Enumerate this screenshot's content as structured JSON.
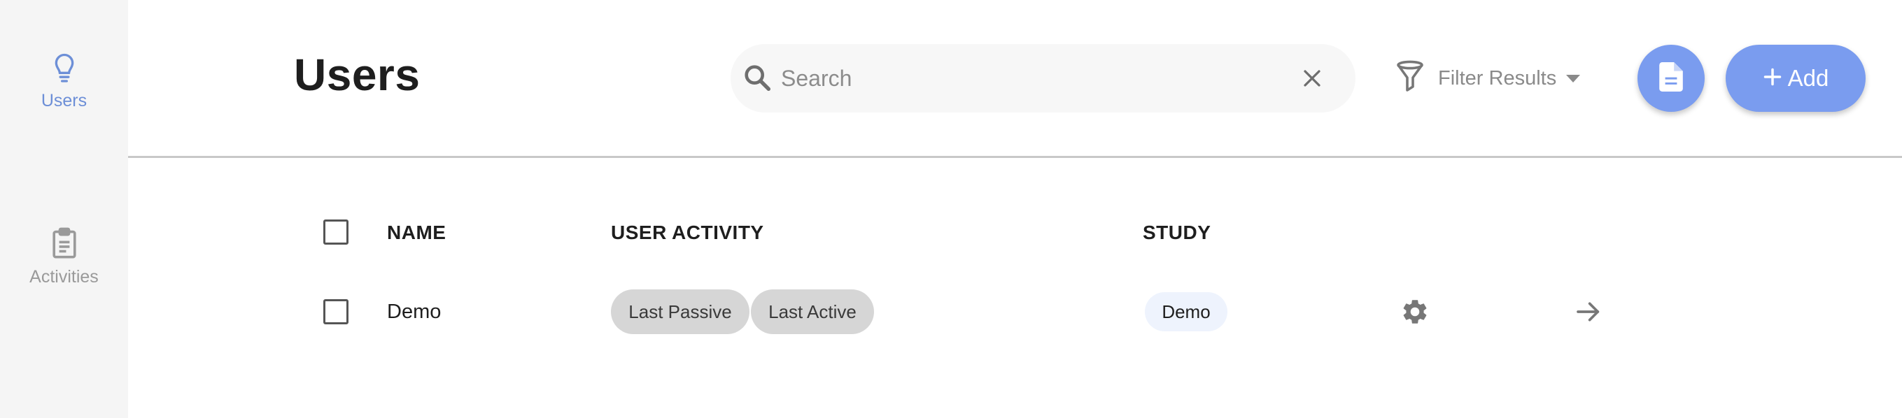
{
  "sidebar": {
    "items": [
      {
        "label": "Users",
        "icon": "lightbulb-icon",
        "active": true,
        "color": "#6d8fd7"
      },
      {
        "label": "Activities",
        "icon": "clipboard-icon",
        "active": false,
        "color": "#9a9a9a"
      }
    ]
  },
  "header": {
    "title": "Users",
    "search": {
      "placeholder": "Search",
      "value": ""
    },
    "filter_label": "Filter Results",
    "add_label": "Add",
    "accent_color": "#7a9cef"
  },
  "table": {
    "columns": [
      "NAME",
      "USER ACTIVITY",
      "STUDY"
    ],
    "rows": [
      {
        "name": "Demo",
        "activity": [
          "Last Passive",
          "Last Active"
        ],
        "study": "Demo"
      }
    ]
  }
}
